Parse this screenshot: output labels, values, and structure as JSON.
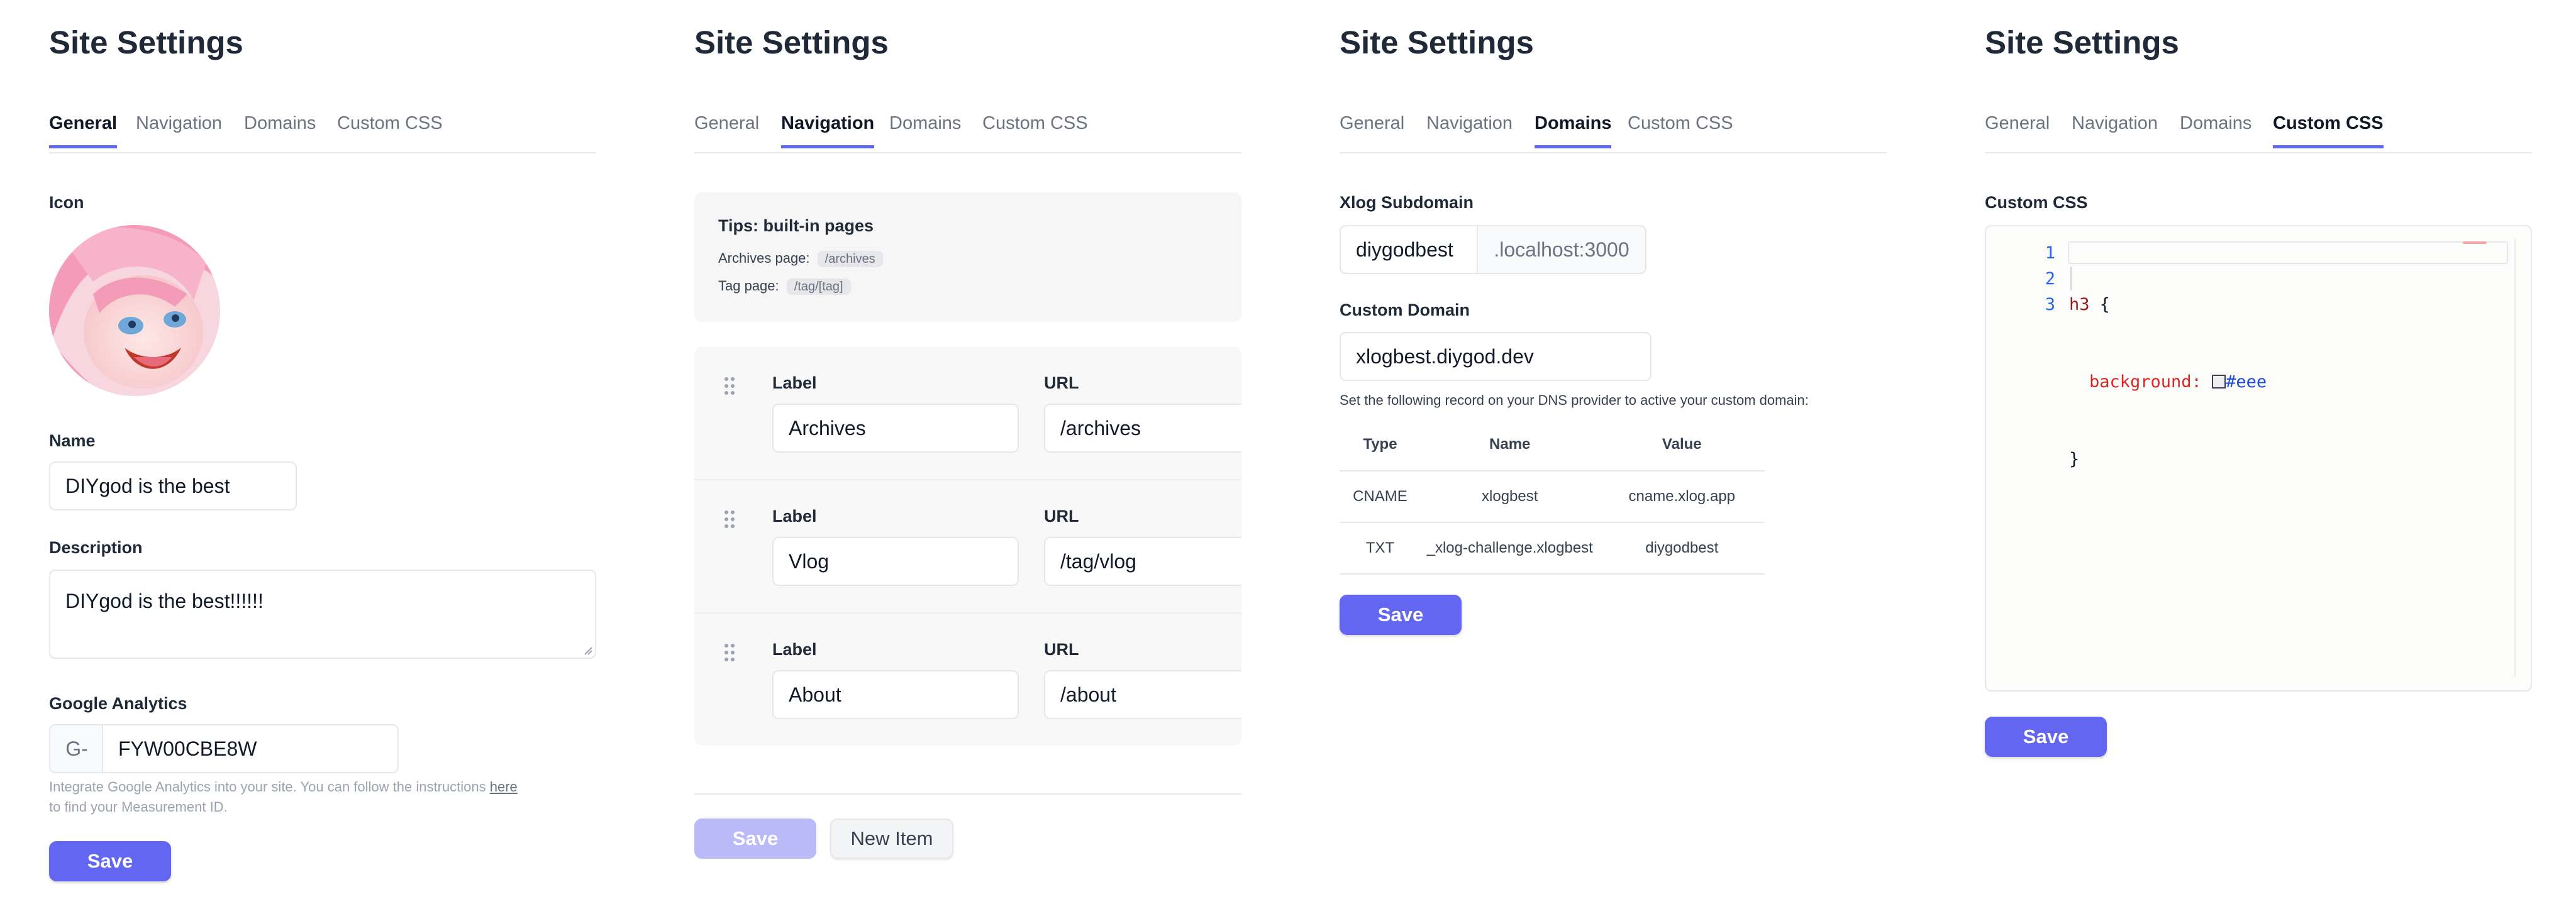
{
  "panels": [
    {
      "title": "Site Settings",
      "tabs": [
        "General",
        "Navigation",
        "Domains",
        "Custom CSS"
      ],
      "active_tab": "General",
      "icon_label": "Icon",
      "name_label": "Name",
      "name_value": "DIYgod is the best",
      "description_label": "Description",
      "description_value": "DIYgod is the best!!!!!!",
      "ga_label": "Google Analytics",
      "ga_prefix": "G-",
      "ga_value": "FYW00CBE8W",
      "ga_help_before": "Integrate Google Analytics into your site. You can follow the instructions ",
      "ga_help_link": "here",
      "ga_help_after": "to find your Measurement ID.",
      "save_label": "Save"
    },
    {
      "title": "Site Settings",
      "tabs": [
        "General",
        "Navigation",
        "Domains",
        "Custom CSS"
      ],
      "active_tab": "Navigation",
      "tips_title": "Tips: built-in pages",
      "tips": [
        {
          "label": "Archives page:",
          "code": "/archives"
        },
        {
          "label": "Tag page:",
          "code": "/tag/[tag]"
        }
      ],
      "label_header": "Label",
      "url_header": "URL",
      "items": [
        {
          "label": "Archives",
          "url": "/archives"
        },
        {
          "label": "Vlog",
          "url": "/tag/vlog"
        },
        {
          "label": "About",
          "url": "/about"
        }
      ],
      "save_label": "Save",
      "new_item_label": "New Item"
    },
    {
      "title": "Site Settings",
      "tabs": [
        "General",
        "Navigation",
        "Domains",
        "Custom CSS"
      ],
      "active_tab": "Domains",
      "subdomain_label": "Xlog Subdomain",
      "subdomain_value": "diygodbest",
      "subdomain_suffix": ".localhost:3000",
      "custom_domain_label": "Custom Domain",
      "custom_domain_value": "xlogbest.diygod.dev",
      "dns_hint": "Set the following record on your DNS provider to active your custom domain:",
      "dns_headers": [
        "Type",
        "Name",
        "Value"
      ],
      "dns_records": [
        [
          "CNAME",
          "xlogbest",
          "cname.xlog.app"
        ],
        [
          "TXT",
          "_xlog-challenge.xlogbest",
          "diygodbest"
        ]
      ],
      "save_label": "Save"
    },
    {
      "title": "Site Settings",
      "tabs": [
        "General",
        "Navigation",
        "Domains",
        "Custom CSS"
      ],
      "active_tab": "Custom CSS",
      "css_label": "Custom CSS",
      "line_numbers": [
        "1",
        "2",
        "3"
      ],
      "code_selector": "h3",
      "code_open": "{",
      "code_property": "background:",
      "code_value": "#eee",
      "code_close": "}",
      "save_label": "Save"
    }
  ],
  "colors": {
    "accent": "#6366f1",
    "accent_disabled": "#b9baf7"
  }
}
